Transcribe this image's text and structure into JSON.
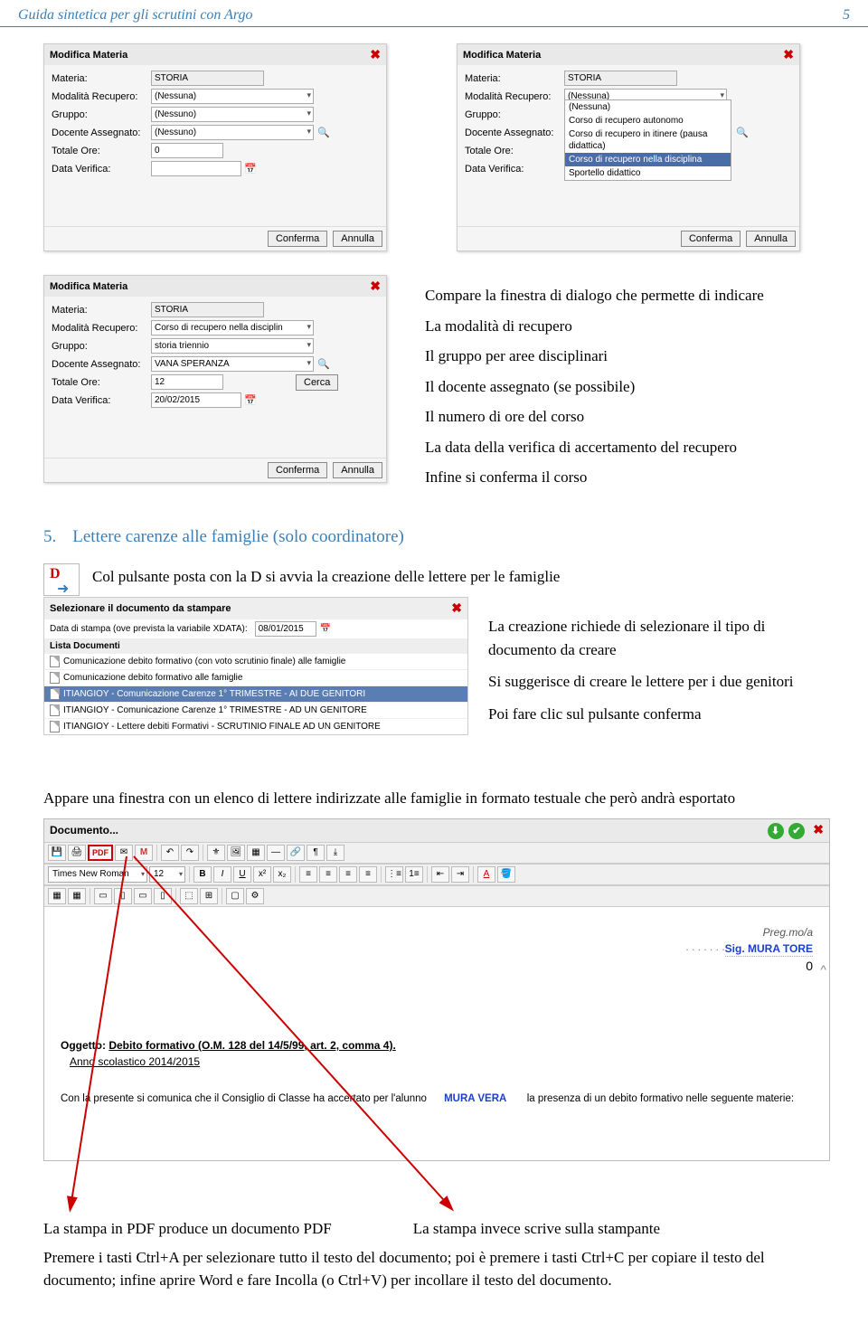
{
  "page_header": {
    "title": "Guida sintetica per gli scrutini con Argo",
    "page_num": "5"
  },
  "dialogA": {
    "title": "Modifica Materia",
    "materia_label": "Materia:",
    "materia_value": "STORIA",
    "modalita_label": "Modalità Recupero:",
    "modalita_value": "(Nessuna)",
    "gruppo_label": "Gruppo:",
    "gruppo_value": "(Nessuno)",
    "docente_label": "Docente Assegnato:",
    "docente_value": "(Nessuno)",
    "ore_label": "Totale Ore:",
    "ore_value": "0",
    "data_label": "Data Verifica:",
    "data_value": "",
    "confirm": "Conferma",
    "cancel": "Annulla"
  },
  "dialogB": {
    "title": "Modifica Materia",
    "materia_label": "Materia:",
    "materia_value": "STORIA",
    "modalita_label": "Modalità Recupero:",
    "modalita_value": "(Nessuna)",
    "gruppo_label": "Gruppo:",
    "docente_label": "Docente Assegnato:",
    "ore_label": "Totale Ore:",
    "data_label": "Data Verifica:",
    "options": [
      "(Nessuna)",
      "Corso di recupero autonomo",
      "Corso di recupero in itinere (pausa didattica)",
      "Corso di recupero nella disciplina",
      "Sportello didattico"
    ],
    "selected_index": 3,
    "confirm": "Conferma",
    "cancel": "Annulla"
  },
  "dialogC": {
    "title": "Modifica Materia",
    "materia_label": "Materia:",
    "materia_value": "STORIA",
    "modalita_label": "Modalità Recupero:",
    "modalita_value": "Corso di recupero nella disciplin",
    "gruppo_label": "Gruppo:",
    "gruppo_value": "storia triennio",
    "docente_label": "Docente Assegnato:",
    "docente_value": "VANA SPERANZA",
    "ore_label": "Totale Ore:",
    "ore_value": "12",
    "data_label": "Data Verifica:",
    "data_value": "20/02/2015",
    "cerca": "Cerca",
    "confirm": "Conferma",
    "cancel": "Annulla"
  },
  "right_col": {
    "line1": "Compare la finestra di dialogo che permette di indicare",
    "line2": "La modalità di recupero",
    "line3": "Il gruppo per aree disciplinari",
    "line4": "Il docente assegnato (se possibile)",
    "line5": "Il numero di ore del corso",
    "line6": "La data della verifica di accertamento del recupero",
    "line7": "Infine si conferma il corso"
  },
  "section5": {
    "num": "5.",
    "title": "Lettere carenze alle famiglie (solo coordinatore)",
    "text": "Col pulsante posta con la D si avvia la creazione delle lettere per le famiglie"
  },
  "doc_select": {
    "header": "Selezionare il documento da stampare",
    "date_label": "Data di stampa (ove prevista la variabile XDATA):",
    "date_value": "08/01/2015",
    "list_header": "Lista Documenti",
    "items": [
      "Comunicazione debito formativo (con voto scrutinio finale) alle famiglie",
      "Comunicazione debito formativo alle famiglie",
      "ITIANGIOY - Comunicazione Carenze 1° TRIMESTRE - AI DUE GENITORI",
      "ITIANGIOY - Comunicazione Carenze 1° TRIMESTRE - AD UN GENITORE",
      "ITIANGIOY - Lettere debiti Formativi - SCRUTINIO FINALE AD UN GENITORE"
    ],
    "selected_index": 2
  },
  "right_notes": {
    "l1": "La creazione richiede di selezionare il tipo di documento da creare",
    "l2": "Si suggerisce di creare le lettere per i due genitori",
    "l3": "Poi fare clic sul pulsante conferma"
  },
  "para_appare": "Appare una finestra con un elenco di lettere indirizzate alle famiglie in formato testuale che però andrà esportato",
  "editor": {
    "title": "Documento...",
    "pdf_label": "PDF",
    "font": "Times New Roman",
    "size": "12",
    "preg": "Preg.mo/a",
    "sig": "Sig. MURA TORE",
    "zero": "0",
    "oggetto_prefix": "Oggetto:",
    "oggetto": "Debito formativo (O.M. 128 del 14/5/99, art. 2, comma 4).",
    "anno": "Anno scolastico 2014/2015",
    "body_pre": "Con la  presente si comunica che il Consiglio di Classe ha accertato per l'alunno",
    "student": "MURA VERA",
    "body_post": "la presenza di un debito formativo nelle seguente materie:"
  },
  "bottom": {
    "left": "La stampa in PDF produce un documento PDF",
    "right": "La stampa invece scrive sulla stampante",
    "para": "Premere i tasti Ctrl+A per selezionare tutto il testo del documento; poi è premere i tasti Ctrl+C per copiare il testo del documento; infine aprire Word e fare Incolla (o Ctrl+V) per incollare il testo del documento."
  }
}
